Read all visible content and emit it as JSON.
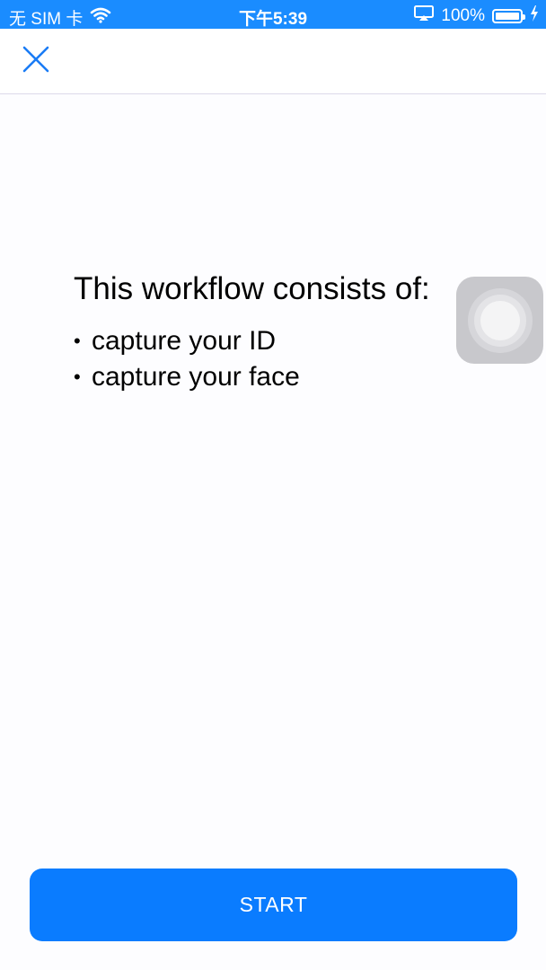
{
  "status_bar": {
    "carrier": "无 SIM 卡",
    "time": "下午5:39",
    "battery": "100%",
    "battery_level": 1.0,
    "background_color": "#1a8cff",
    "icons": [
      "wifi-icon",
      "airplay-icon",
      "battery-icon",
      "charging-icon"
    ]
  },
  "nav": {
    "close_icon": "close-icon",
    "accent_color": "#1a7cf5"
  },
  "content": {
    "heading": "This workflow consists of:",
    "bullet": "•",
    "steps": [
      "capture your ID",
      "capture your face"
    ]
  },
  "assistive_touch": {
    "icon": "assistive-touch-icon"
  },
  "start_button": {
    "label": "START",
    "color": "#0a7cff"
  }
}
